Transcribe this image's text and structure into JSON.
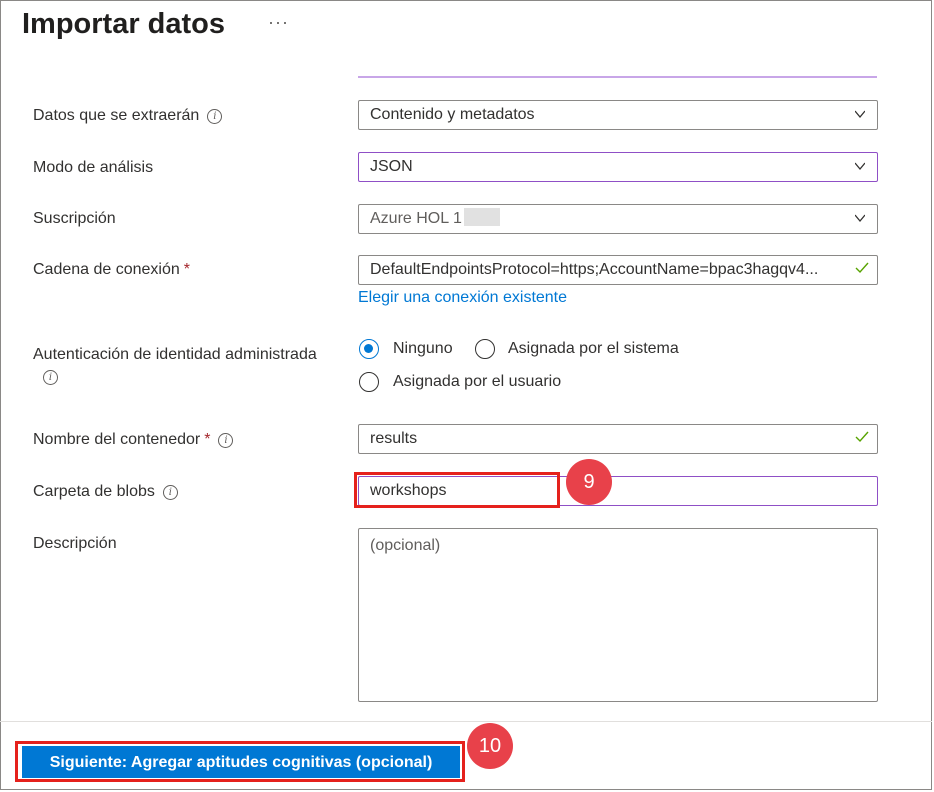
{
  "header": {
    "title": "Importar datos",
    "more_label": "···"
  },
  "form": {
    "data_to_extract": {
      "label": "Datos que se extraerán",
      "value": "Contenido y metadatos"
    },
    "parsing_mode": {
      "label": "Modo de análisis",
      "value": "JSON"
    },
    "subscription": {
      "label": "Suscripción",
      "value": "Azure HOL 1"
    },
    "connection_string": {
      "label": "Cadena de conexión",
      "required_mark": "*",
      "value": "DefaultEndpointsProtocol=https;AccountName=bpac3hagqv4...",
      "link": "Elegir una conexión existente"
    },
    "managed_identity": {
      "label": "Autenticación de identidad administrada",
      "options": [
        "Ninguno",
        "Asignada por el sistema",
        "Asignada por el usuario"
      ],
      "selected": "Ninguno"
    },
    "container_name": {
      "label": "Nombre del contenedor",
      "required_mark": "*",
      "value": "results"
    },
    "blob_folder": {
      "label": "Carpeta de blobs",
      "value": "workshops"
    },
    "description": {
      "label": "Descripción",
      "placeholder": "(opcional)"
    }
  },
  "annotations": {
    "step9": "9",
    "step10": "10"
  },
  "footer": {
    "next_button": "Siguiente: Agregar aptitudes cognitivas (opcional)"
  },
  "colors": {
    "primary": "#0078d4",
    "accent_purple": "#8f4fc6",
    "highlight_red": "#e5211c",
    "badge": "#e8414a"
  },
  "icons": [
    "more-icon",
    "info-icon",
    "chevron-down-icon",
    "checkmark-icon"
  ]
}
